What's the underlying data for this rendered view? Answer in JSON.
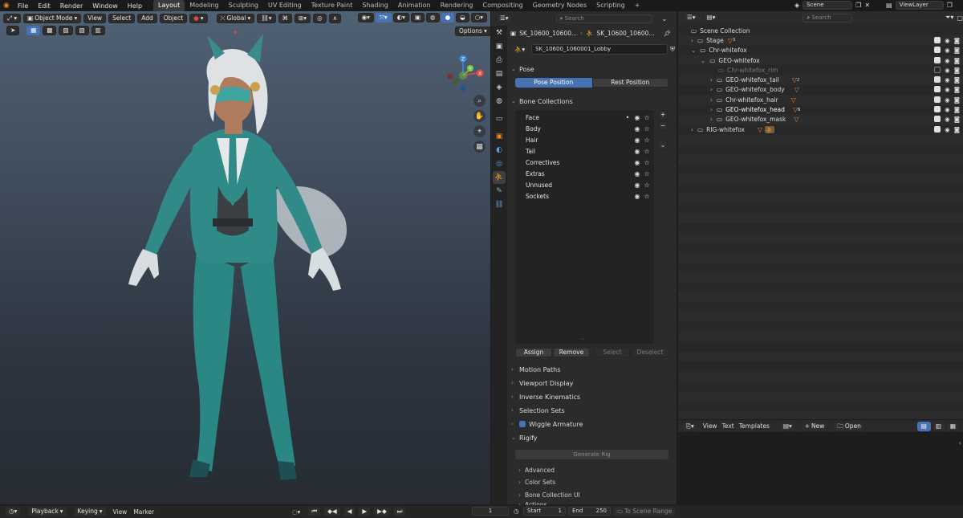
{
  "topbar": {
    "menus": [
      "File",
      "Edit",
      "Render",
      "Window",
      "Help"
    ],
    "workspaces": [
      "Layout",
      "Modeling",
      "Sculpting",
      "UV Editing",
      "Texture Paint",
      "Shading",
      "Animation",
      "Rendering",
      "Compositing",
      "Geometry Nodes",
      "Scripting"
    ],
    "active_workspace": "Layout",
    "scene": "Scene",
    "view_layer": "ViewLayer"
  },
  "viewport": {
    "mode": "Object Mode",
    "menus": [
      "View",
      "Select",
      "Add",
      "Object"
    ],
    "transform_orientation": "Global",
    "options_label": "Options",
    "gizmo": {
      "x": "X",
      "y": "Y",
      "z": "Z"
    }
  },
  "properties": {
    "search_placeholder": "Search",
    "breadcrumb_object": "SK_10600_10600...",
    "breadcrumb_data": "SK_10600_10600...",
    "armature_name": "SK_10600_1060001_Lobby",
    "pose_panel": {
      "title": "Pose",
      "pose_position": "Pose Position",
      "rest_position": "Rest Position"
    },
    "bone_collections": {
      "title": "Bone Collections",
      "items": [
        "Face",
        "Body",
        "Hair",
        "Tail",
        "Correctives",
        "Extras",
        "Unnused",
        "Sockets"
      ],
      "assign": "Assign",
      "remove": "Remove",
      "select": "Select",
      "deselect": "Deselect"
    },
    "panels": [
      "Motion Paths",
      "Viewport Display",
      "Inverse Kinematics",
      "Selection Sets",
      "Wiggle Armature",
      "Rigify"
    ],
    "rigify": {
      "generate": "Generate Rig",
      "subpanels": [
        "Advanced",
        "Color Sets",
        "Bone Collection UI",
        "Actions"
      ]
    }
  },
  "outliner": {
    "search_placeholder": "Search",
    "rows": [
      {
        "label": "Scene Collection",
        "indent": 0
      },
      {
        "label": "Stage",
        "indent": 1,
        "badge": "3"
      },
      {
        "label": "Chr-whitefox",
        "indent": 1
      },
      {
        "label": "GEO-whitefox",
        "indent": 2
      },
      {
        "label": "Chr-whitefox_rim",
        "indent": 3
      },
      {
        "label": "GEO-whitefox_tail",
        "indent": 3,
        "badge": "2"
      },
      {
        "label": "GEO-whitefox_body",
        "indent": 3
      },
      {
        "label": "Chr-whitefox_hair",
        "indent": 3
      },
      {
        "label": "GEO-whitefox_head",
        "indent": 3,
        "badge": "6"
      },
      {
        "label": "GEO-whitefox_mask",
        "indent": 3
      },
      {
        "label": "RIG-whitefox",
        "indent": 1
      }
    ]
  },
  "text_editor": {
    "menus": [
      "View",
      "Text",
      "Templates"
    ],
    "new_label": "New",
    "open_label": "Open"
  },
  "timeline": {
    "menus": [
      "Playback",
      "Keying",
      "View",
      "Marker"
    ],
    "current_frame": "1",
    "start_label": "Start",
    "start_value": "1",
    "end_label": "End",
    "end_value": "250",
    "scene_range": "To Scene Range"
  },
  "colors": {
    "accent_blue": "#4772b3",
    "mesh_orange": "#e8852c",
    "suit_teal": "#2f8a88"
  }
}
